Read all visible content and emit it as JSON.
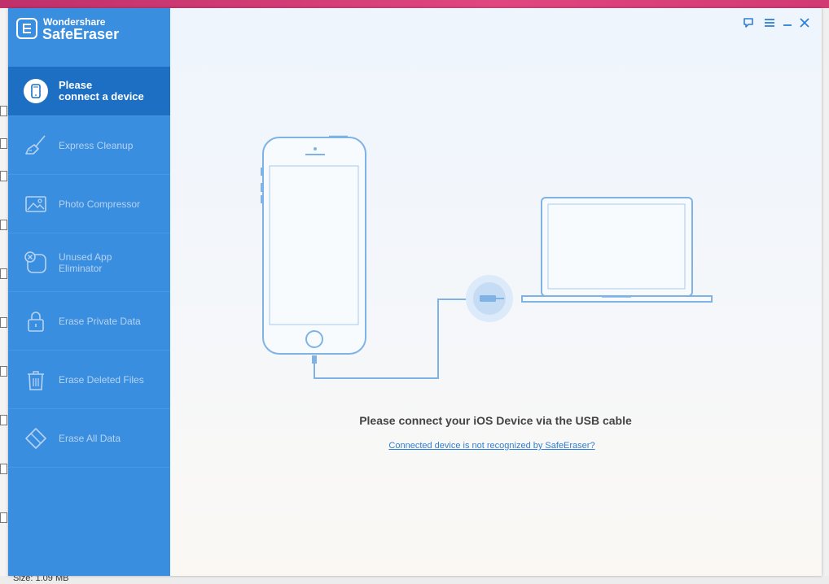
{
  "background": {
    "status_text": "Size: 1.09 MB"
  },
  "brand": {
    "company": "Wondershare",
    "product": "SafeEraser",
    "logo_icon": "safeeraser-logo-icon"
  },
  "window_controls": {
    "icons": [
      "feedback-icon",
      "menu-icon",
      "minimize-icon",
      "close-icon"
    ]
  },
  "sidebar": {
    "items": [
      {
        "label_line1": "Please",
        "label_line2": "connect a device",
        "icon": "phone-icon",
        "active": true
      },
      {
        "label": "Express Cleanup",
        "icon": "broom-icon",
        "active": false
      },
      {
        "label": "Photo Compressor",
        "icon": "photo-icon",
        "active": false
      },
      {
        "label_line1": "Unused App",
        "label_line2": "Eliminator",
        "icon": "app-remove-icon",
        "active": false
      },
      {
        "label": "Erase Private Data",
        "icon": "lock-icon",
        "active": false
      },
      {
        "label": "Erase Deleted Files",
        "icon": "trash-icon",
        "active": false
      },
      {
        "label": "Erase All Data",
        "icon": "eraser-icon",
        "active": false
      }
    ]
  },
  "main": {
    "title": "Please connect your iOS Device via the USB cable",
    "help_link": "Connected device is not recognized by SafeEraser?"
  },
  "colors": {
    "sidebar_bg": "#3a8ee0",
    "sidebar_active_bg": "#1d6fc4",
    "sidebar_inactive_text": "#b6d3f1",
    "illustration_stroke": "#7fb3e5",
    "link": "#2f7fd6"
  }
}
